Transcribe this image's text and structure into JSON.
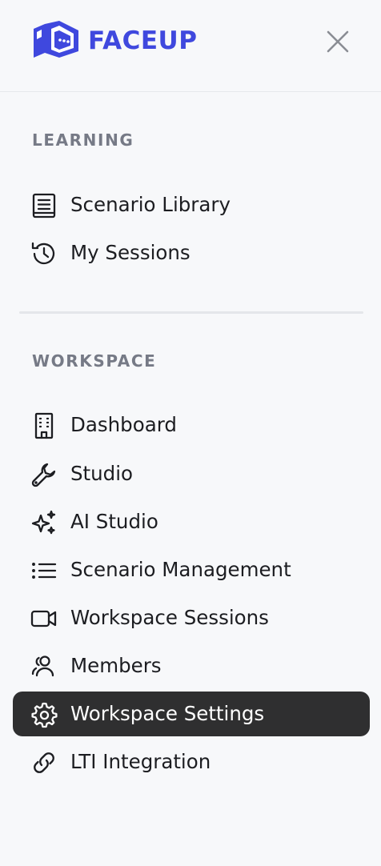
{
  "brand": {
    "name": "FACEUP",
    "color": "#3f48de"
  },
  "header": {
    "close_icon": "close-icon"
  },
  "sections": [
    {
      "label": "LEARNING",
      "items": [
        {
          "label": "Scenario Library",
          "icon": "book-icon"
        },
        {
          "label": "My Sessions",
          "icon": "history-icon"
        }
      ]
    },
    {
      "label": "WORKSPACE",
      "items": [
        {
          "label": "Dashboard",
          "icon": "building-icon"
        },
        {
          "label": "Studio",
          "icon": "wrench-icon"
        },
        {
          "label": "AI Studio",
          "icon": "sparkles-icon"
        },
        {
          "label": "Scenario Management",
          "icon": "list-icon"
        },
        {
          "label": "Workspace Sessions",
          "icon": "video-icon"
        },
        {
          "label": "Members",
          "icon": "users-icon"
        },
        {
          "label": "Workspace Settings",
          "icon": "gear-icon",
          "active": true
        },
        {
          "label": "LTI Integration",
          "icon": "link-icon"
        }
      ]
    }
  ],
  "colors": {
    "active_background": "#2f2f30",
    "section_label": "#767a86",
    "background": "#f7f8fa"
  }
}
